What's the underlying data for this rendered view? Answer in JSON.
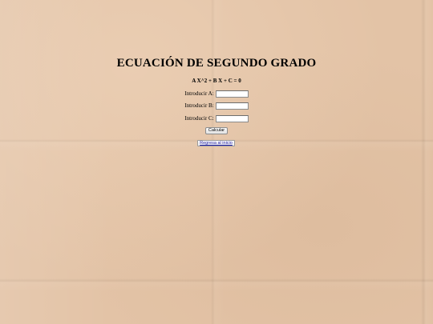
{
  "page": {
    "title": "ECUACIÓN DE SEGUNDO GRADO",
    "equation": "A X^2 + B X + C = 0"
  },
  "form": {
    "fields": [
      {
        "label": "Introducir A:",
        "value": ""
      },
      {
        "label": "Introducir B:",
        "value": ""
      },
      {
        "label": "Introducir C:",
        "value": ""
      }
    ],
    "submit_label": "Calcular"
  },
  "nav": {
    "back_label": "Regresa al inicio"
  }
}
